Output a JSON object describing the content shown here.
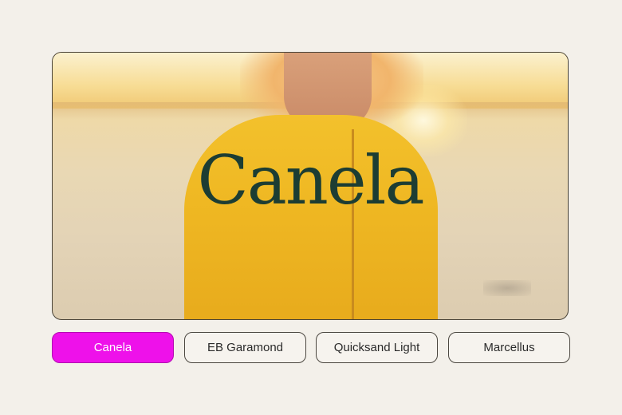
{
  "hero": {
    "featured_font_name": "Canela"
  },
  "font_options": [
    {
      "label": "Canela",
      "selected": true
    },
    {
      "label": "EB Garamond",
      "selected": false
    },
    {
      "label": "Quicksand Light",
      "selected": false
    },
    {
      "label": "Marcellus",
      "selected": false
    }
  ],
  "colors": {
    "selected_accent": "#ee11ea",
    "brand_text": "#1c3d33",
    "background": "#f3f0ea"
  }
}
